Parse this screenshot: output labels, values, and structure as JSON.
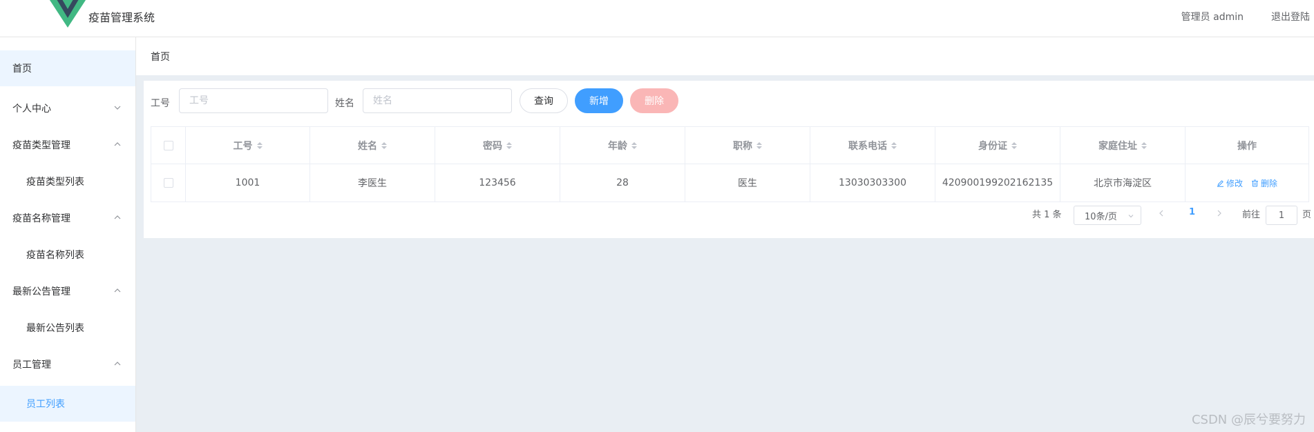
{
  "header": {
    "app_title": "疫苗管理系统",
    "user_text": "管理员 admin",
    "logout_label": "退出登陆"
  },
  "sidebar": {
    "items": [
      {
        "label": "首页"
      },
      {
        "label": "个人中心"
      },
      {
        "label": "疫苗类型管理"
      },
      {
        "label": "疫苗类型列表"
      },
      {
        "label": "疫苗名称管理"
      },
      {
        "label": "疫苗名称列表"
      },
      {
        "label": "最新公告管理"
      },
      {
        "label": "最新公告列表"
      },
      {
        "label": "员工管理"
      },
      {
        "label": "员工列表"
      }
    ]
  },
  "breadcrumb": {
    "current": "首页"
  },
  "search": {
    "id_label": "工号",
    "id_placeholder": "工号",
    "name_label": "姓名",
    "name_placeholder": "姓名",
    "query_label": "查询",
    "add_label": "新增",
    "delete_label": "删除"
  },
  "table": {
    "columns": [
      "工号",
      "姓名",
      "密码",
      "年龄",
      "职称",
      "联系电话",
      "身份证",
      "家庭住址",
      "操作"
    ],
    "rows": [
      {
        "cells": [
          "1001",
          "李医生",
          "123456",
          "28",
          "医生",
          "13030303300",
          "420900199202162135",
          "北京市海淀区"
        ],
        "edit_label": "修改",
        "delete_label": "删除"
      }
    ]
  },
  "pagination": {
    "total_text": "共 1 条",
    "page_size": "10条/页",
    "current_page": "1",
    "goto_label": "前往",
    "goto_value": "1",
    "page_suffix": "页"
  },
  "watermark": "CSDN @辰兮要努力",
  "colors": {
    "primary": "#409eff",
    "danger_disabled": "#fab6b6",
    "active_bg": "#ecf5ff",
    "main_bg": "#e9eef3",
    "logo_green": "#41b883",
    "logo_dark": "#35495e"
  },
  "icons": [
    "vue-logo-icon",
    "chevron-down-icon",
    "chevron-up-icon",
    "sort-caret-icon",
    "edit-icon",
    "trash-icon",
    "chevron-left-icon",
    "chevron-right-icon"
  ]
}
